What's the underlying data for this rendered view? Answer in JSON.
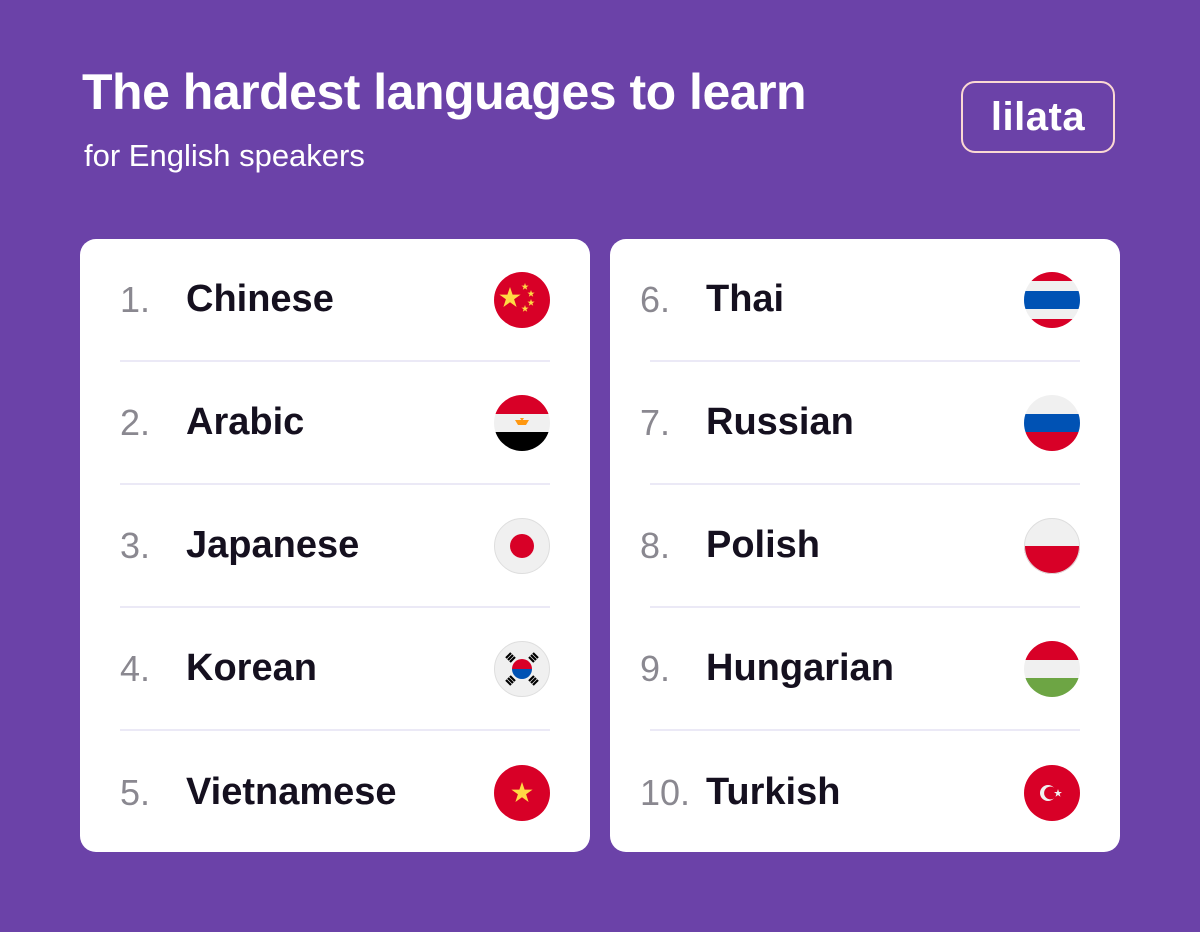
{
  "header": {
    "title": "The hardest languages to learn",
    "subtitle": "for English speakers",
    "logo_text": "lilata"
  },
  "colors": {
    "background": "#6b42a8",
    "card": "#ffffff",
    "number": "#8a8890",
    "language": "#15101f",
    "divider": "#ebe9f6",
    "logo_border": "#fbd9d3"
  },
  "lists": {
    "left": [
      {
        "rank": "1.",
        "language": "Chinese",
        "flag": "china-flag-icon"
      },
      {
        "rank": "2.",
        "language": "Arabic",
        "flag": "egypt-flag-icon"
      },
      {
        "rank": "3.",
        "language": "Japanese",
        "flag": "japan-flag-icon"
      },
      {
        "rank": "4.",
        "language": "Korean",
        "flag": "south-korea-flag-icon"
      },
      {
        "rank": "5.",
        "language": "Vietnamese",
        "flag": "vietnam-flag-icon"
      }
    ],
    "right": [
      {
        "rank": "6.",
        "language": "Thai",
        "flag": "thailand-flag-icon"
      },
      {
        "rank": "7.",
        "language": "Russian",
        "flag": "russia-flag-icon"
      },
      {
        "rank": "8.",
        "language": "Polish",
        "flag": "poland-flag-icon"
      },
      {
        "rank": "9.",
        "language": "Hungarian",
        "flag": "hungary-flag-icon"
      },
      {
        "rank": "10.",
        "language": "Turkish",
        "flag": "turkey-flag-icon"
      }
    ]
  }
}
